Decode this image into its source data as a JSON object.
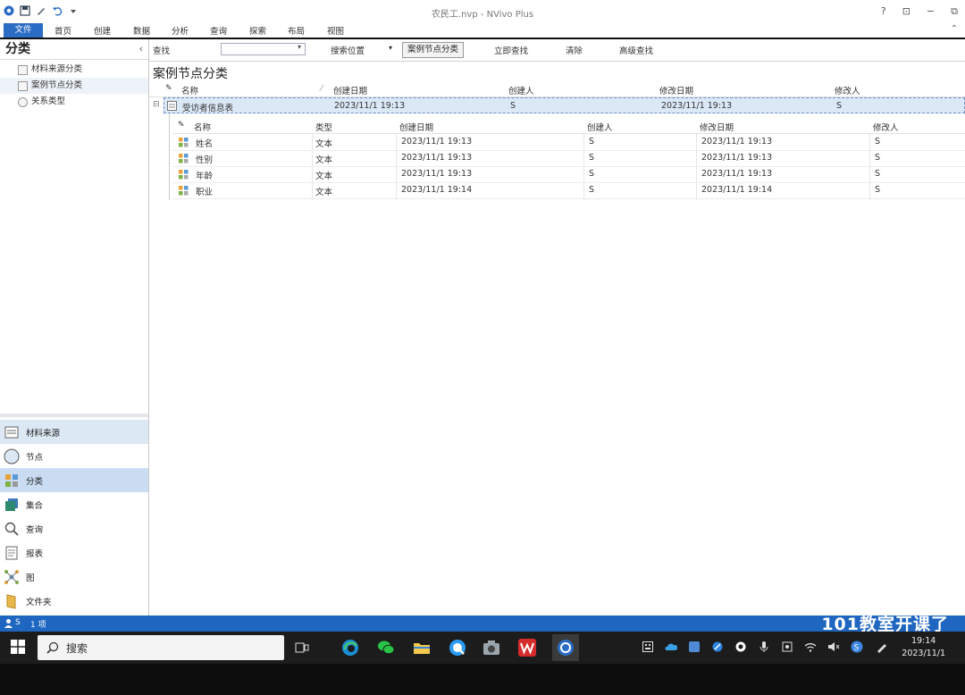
{
  "window": {
    "title": "农民工.nvp - NVivo Plus",
    "buttons": [
      "?",
      "⊡",
      "−",
      "⧉"
    ]
  },
  "menu": {
    "file": "文件",
    "items": [
      "首页",
      "创建",
      "数据",
      "分析",
      "查询",
      "探索",
      "布局",
      "视图"
    ]
  },
  "left": {
    "title": "分类",
    "collapse": "‹",
    "tree": [
      {
        "label": "材料来源分类"
      },
      {
        "label": "案例节点分类"
      },
      {
        "label": "关系类型"
      }
    ],
    "nav": [
      {
        "label": "材料来源"
      },
      {
        "label": "节点"
      },
      {
        "label": "分类"
      },
      {
        "label": "集合"
      },
      {
        "label": "查询"
      },
      {
        "label": "报表"
      },
      {
        "label": "图"
      },
      {
        "label": "文件夹"
      }
    ]
  },
  "search": {
    "label": "查找",
    "value": "",
    "scope_label": "搜索位置",
    "scope_value": "案例节点分类",
    "find_now": "立即查找",
    "clear": "清除",
    "advanced": "高级查找"
  },
  "main": {
    "title": "案例节点分类",
    "parent_header": [
      "名称",
      "创建日期",
      "创建人",
      "修改日期",
      "修改人"
    ],
    "parent_row": {
      "name": "受访者信息表",
      "created": "2023/11/1 19:13",
      "creator": "S",
      "modified": "2023/11/1 19:13",
      "modifier": "S"
    },
    "child_header": [
      "名称",
      "类型",
      "创建日期",
      "创建人",
      "修改日期",
      "修改人"
    ],
    "child_rows": [
      {
        "name": "姓名",
        "type": "文本",
        "created": "2023/11/1 19:13",
        "creator": "S",
        "modified": "2023/11/1 19:13",
        "modifier": "S"
      },
      {
        "name": "性别",
        "type": "文本",
        "created": "2023/11/1 19:13",
        "creator": "S",
        "modified": "2023/11/1 19:13",
        "modifier": "S"
      },
      {
        "name": "年龄",
        "type": "文本",
        "created": "2023/11/1 19:13",
        "creator": "S",
        "modified": "2023/11/1 19:13",
        "modifier": "S"
      },
      {
        "name": "职业",
        "type": "文本",
        "created": "2023/11/1 19:14",
        "creator": "S",
        "modified": "2023/11/1 19:14",
        "modifier": "S"
      }
    ]
  },
  "status": {
    "user": "S",
    "items": "1 项"
  },
  "watermark": "101教室开课了",
  "taskbar": {
    "search_placeholder": "搜索",
    "time": "19:14",
    "date": "2023/11/1"
  },
  "colors": {
    "accent": "#2b6cc4",
    "status": "#1f66c1",
    "selection": "#dbe8f6"
  }
}
